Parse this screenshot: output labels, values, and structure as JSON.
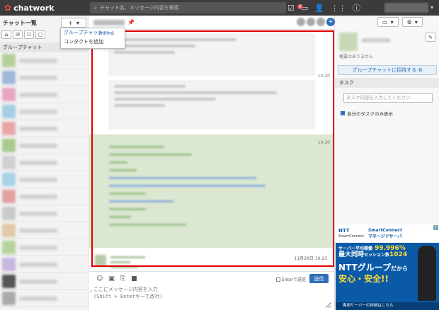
{
  "app": {
    "logo": "chatwork",
    "brand_color": "#e34a4a"
  },
  "search": {
    "placeholder": "チャット名、メッセージ内容を検索"
  },
  "topbar": {
    "task_badge": "6"
  },
  "sidebar": {
    "title": "チャット一覧",
    "add_label": "+",
    "section_label": "グループチャット",
    "menu": {
      "group_chat": "グループチャット",
      "new_create": "新規作成",
      "add_contact": "コンタクトを追加"
    }
  },
  "chat": {
    "timestamps": [
      "10:20",
      "10:20"
    ],
    "last_timestamp": "11月28日 10:23",
    "toolbar": {
      "enter_send": "Enterで送信",
      "send": "送信"
    },
    "input_placeholder": "ここにメッセージ内容を入力\n(Shift + Enterキーで改行)"
  },
  "right": {
    "desc": "概要はありません",
    "invite": "グループチャットに招待する",
    "task_title": "タスク",
    "task_placeholder": "タスク内容を入力してください",
    "my_task": "自分のタスクのみ表示"
  },
  "ad": {
    "ntt": "NTT",
    "ntt_sub": "SmartConnect",
    "smartconnect": "SmartConnect",
    "managed": "マネージドサーバ",
    "line1_pre": "サーバー平均稼働",
    "line1_val": "99.996%",
    "line2_pre": "最大同時",
    "line2_mid": "セッション数",
    "line2_val": "1024",
    "headline1": "NTTグループ",
    "headline1b": "だから",
    "headline2": "安心・安全!!",
    "footer": "専用サーバーの詳細はこちら",
    "info": "i"
  }
}
